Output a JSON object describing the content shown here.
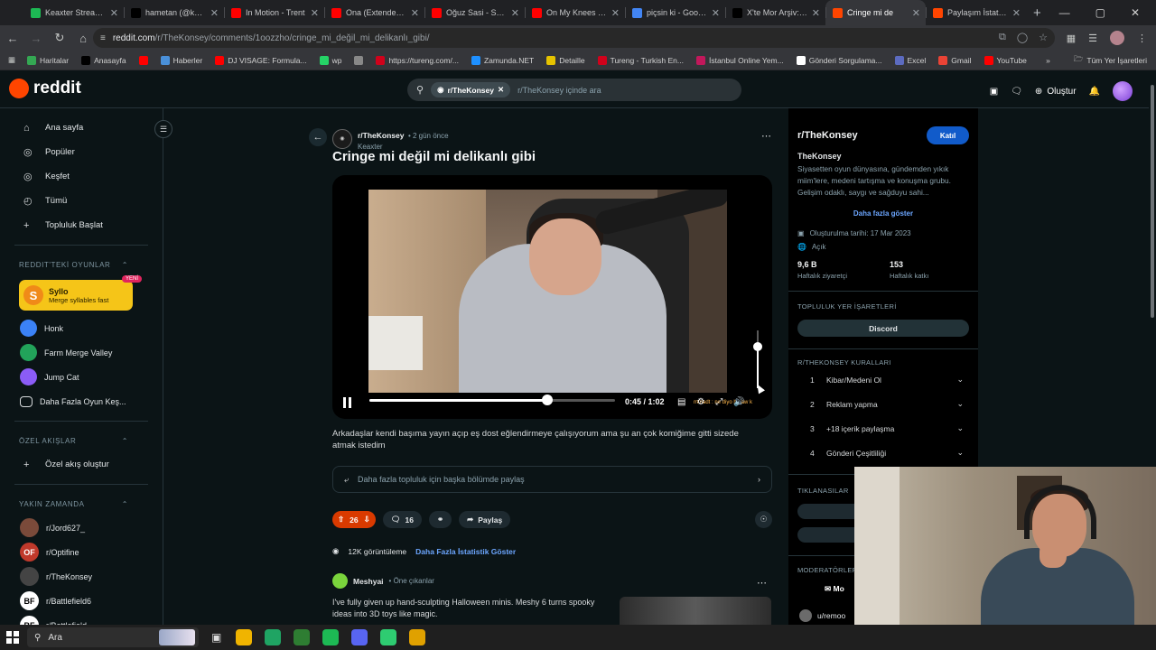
{
  "browser": {
    "tabs": [
      {
        "title": "Keaxter Stream - ¶",
        "color": "#1db954"
      },
      {
        "title": "hametan (@keaxt",
        "color": "#000000"
      },
      {
        "title": "In Motion - Trent",
        "color": "#ff0000"
      },
      {
        "title": "Ona (Extended M",
        "color": "#ff0000"
      },
      {
        "title": "Oğuz Sasi - Sosyal",
        "color": "#ff0000"
      },
      {
        "title": "On My Knees - Yo",
        "color": "#ff0000"
      },
      {
        "title": "piçsin ki - Google",
        "color": "#4285f4"
      },
      {
        "title": "X'te Mor Arşiv: \"P",
        "color": "#000000"
      },
      {
        "title": "Cringe mi de",
        "color": "#ff4500"
      },
      {
        "title": "Paylaşım İstatisti",
        "color": "#ff4500"
      }
    ],
    "active_tab": 8,
    "new_tab": "+",
    "url_host": "reddit.com",
    "url_path": "/r/TheKonsey/comments/1oozzho/cringe_mi_değil_mi_delikanlı_gibi/",
    "bookmarks": [
      {
        "label": "Haritalar",
        "color": "#34a853"
      },
      {
        "label": "Anasayfa",
        "color": "#000000"
      },
      {
        "label": "",
        "color": "#ff0000"
      },
      {
        "label": "Haberler",
        "color": "#4a90d9"
      },
      {
        "label": "DJ VISAGE: Formula...",
        "color": "#ff0000"
      },
      {
        "label": "wp",
        "color": "#25d366"
      },
      {
        "label": "",
        "color": "#888888"
      },
      {
        "label": "https://tureng.com/...",
        "color": "#d0021b"
      },
      {
        "label": "Zamunda.NET",
        "color": "#1e90ff"
      },
      {
        "label": "Detaille",
        "color": "#e6c300"
      },
      {
        "label": "Tureng - Turkish En...",
        "color": "#d0021b"
      },
      {
        "label": "İstanbul Online Yem...",
        "color": "#c2185b"
      },
      {
        "label": "Gönderi Sorgulama...",
        "color": "#ffffff"
      },
      {
        "label": "Excel",
        "color": "#5c6bc0"
      },
      {
        "label": "Gmail",
        "color": "#ea4335"
      },
      {
        "label": "YouTube",
        "color": "#ff0000"
      }
    ],
    "bookmarks_more": "»",
    "all_bookmarks": "Tüm Yer İşaretleri"
  },
  "reddit": {
    "logo": "reddit",
    "search_chip": "r/TheKonsey",
    "search_placeholder": "r/TheKonsey içinde ara",
    "create_label": "Oluştur"
  },
  "sidebar": {
    "nav": [
      {
        "label": "Ana sayfa",
        "icon": "home-icon"
      },
      {
        "label": "Popüler",
        "icon": "popular-icon"
      },
      {
        "label": "Keşfet",
        "icon": "explore-icon"
      },
      {
        "label": "Tümü",
        "icon": "all-icon"
      },
      {
        "label": "Topluluk Başlat",
        "icon": "plus-icon"
      }
    ],
    "games_header": "REDDIT'TEKİ OYUNLAR",
    "featured_game": {
      "name": "Syllo",
      "desc": "Merge syllables fast",
      "badge": "YENİ"
    },
    "games": [
      {
        "label": "Honk",
        "color": "#3b82f6"
      },
      {
        "label": "Farm Merge Valley",
        "color": "#22a35a"
      },
      {
        "label": "Jump Cat",
        "color": "#8b5cf6"
      },
      {
        "label": "Daha Fazla Oyun Keş...",
        "color": "#0b1416"
      }
    ],
    "feeds_header": "ÖZEL AKIŞLAR",
    "create_feed": "Özel akış oluştur",
    "recent_header": "YAKIN ZAMANDA",
    "recent": [
      {
        "label": "r/Jord627_",
        "initials": "",
        "color": "#7a4a3a"
      },
      {
        "label": "r/Optifine",
        "initials": "OF",
        "color": "#c0392b"
      },
      {
        "label": "r/TheKonsey",
        "initials": "",
        "color": "#444444"
      },
      {
        "label": "r/Battlefield6",
        "initials": "BF",
        "color": "#ffffff"
      },
      {
        "label": "r/Battlefield",
        "initials": "BF",
        "color": "#ffffff"
      }
    ]
  },
  "post": {
    "subreddit": "r/TheKonsey",
    "time": "• 2 gün önce",
    "author": "Keaxter",
    "title": "Cringe mi değil mi delikanlı gibi",
    "video": {
      "time": "0:45 / 1:02",
      "progress": 0.726,
      "volume": 0.72,
      "caption": "mmadt : ne diyo bu aw k"
    },
    "body": "Arkadaşlar kendi başıma yayın açıp eş dost eğlendirmeye çalışıyorum ama şu an çok komiğime gitti sizede atmak istedim",
    "crosspost": "Daha fazla topluluk için başka bölümde paylaş",
    "votes": "26",
    "comments": "16",
    "share": "Paylaş",
    "views": "12K görüntüleme",
    "stats_link": "Daha Fazla İstatistik Göster"
  },
  "ad": {
    "name": "Meshyai",
    "promo": "• Öne çıkanlar",
    "text": "I've fully given up hand-sculpting Halloween minis. Meshy 6 turns spooky ideas into 3D toys like magic."
  },
  "community": {
    "title": "r/TheKonsey",
    "join": "Katıl",
    "name": "TheKonsey",
    "desc": "Siyasetten oyun dünyasına, gündemden yıkık miim'lere, medeni tartışma ve konuşma grubu. Gelişim odaklı, saygı ve sağduyu sahi...",
    "show_more": "Daha fazla göster",
    "created": "Oluşturulma tarihi: 17 Mar 2023",
    "visibility": "Açık",
    "visitors": "9,6 B",
    "visitors_label": "Haftalık ziyaretçi",
    "contributors": "153",
    "contributors_label": "Haftalık katkı",
    "bookmarks_header": "TOPLULUK YER İŞARETLERİ",
    "discord": "Discord",
    "rules_header": "R/THEKONSEY KURALLARI",
    "rules": [
      {
        "num": "1",
        "label": "Kibar/Medeni Ol"
      },
      {
        "num": "2",
        "label": "Reklam yapma"
      },
      {
        "num": "3",
        "label": "+18 içerik paylaşma"
      },
      {
        "num": "4",
        "label": "Gönderi Çeşitliliği"
      }
    ],
    "links_header": "TIKLANASILAR",
    "mods_header": "MODERATÖRLER",
    "message_mods": "Mo",
    "mod_user": "u/remoo"
  },
  "taskbar": {
    "search": "Ara",
    "apps": [
      "#f0b400",
      "#1fa463",
      "#2e7d32",
      "#1db954",
      "#5865f2",
      "#2ecc71",
      "#e0a100"
    ]
  }
}
